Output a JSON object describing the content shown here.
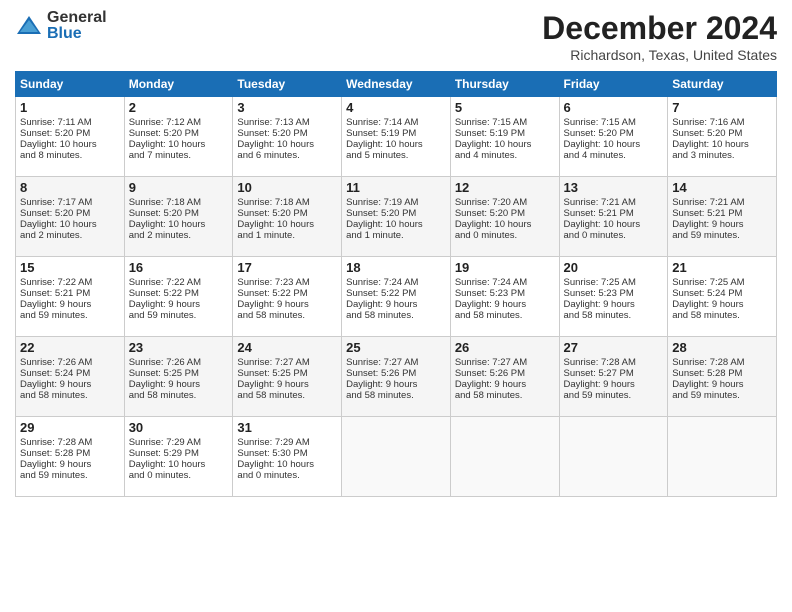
{
  "logo": {
    "general": "General",
    "blue": "Blue"
  },
  "header": {
    "month": "December 2024",
    "location": "Richardson, Texas, United States"
  },
  "weekdays": [
    "Sunday",
    "Monday",
    "Tuesday",
    "Wednesday",
    "Thursday",
    "Friday",
    "Saturday"
  ],
  "weeks": [
    [
      {
        "day": "1",
        "lines": [
          "Sunrise: 7:11 AM",
          "Sunset: 5:20 PM",
          "Daylight: 10 hours",
          "and 8 minutes."
        ]
      },
      {
        "day": "2",
        "lines": [
          "Sunrise: 7:12 AM",
          "Sunset: 5:20 PM",
          "Daylight: 10 hours",
          "and 7 minutes."
        ]
      },
      {
        "day": "3",
        "lines": [
          "Sunrise: 7:13 AM",
          "Sunset: 5:20 PM",
          "Daylight: 10 hours",
          "and 6 minutes."
        ]
      },
      {
        "day": "4",
        "lines": [
          "Sunrise: 7:14 AM",
          "Sunset: 5:19 PM",
          "Daylight: 10 hours",
          "and 5 minutes."
        ]
      },
      {
        "day": "5",
        "lines": [
          "Sunrise: 7:15 AM",
          "Sunset: 5:19 PM",
          "Daylight: 10 hours",
          "and 4 minutes."
        ]
      },
      {
        "day": "6",
        "lines": [
          "Sunrise: 7:15 AM",
          "Sunset: 5:20 PM",
          "Daylight: 10 hours",
          "and 4 minutes."
        ]
      },
      {
        "day": "7",
        "lines": [
          "Sunrise: 7:16 AM",
          "Sunset: 5:20 PM",
          "Daylight: 10 hours",
          "and 3 minutes."
        ]
      }
    ],
    [
      {
        "day": "8",
        "lines": [
          "Sunrise: 7:17 AM",
          "Sunset: 5:20 PM",
          "Daylight: 10 hours",
          "and 2 minutes."
        ]
      },
      {
        "day": "9",
        "lines": [
          "Sunrise: 7:18 AM",
          "Sunset: 5:20 PM",
          "Daylight: 10 hours",
          "and 2 minutes."
        ]
      },
      {
        "day": "10",
        "lines": [
          "Sunrise: 7:18 AM",
          "Sunset: 5:20 PM",
          "Daylight: 10 hours",
          "and 1 minute."
        ]
      },
      {
        "day": "11",
        "lines": [
          "Sunrise: 7:19 AM",
          "Sunset: 5:20 PM",
          "Daylight: 10 hours",
          "and 1 minute."
        ]
      },
      {
        "day": "12",
        "lines": [
          "Sunrise: 7:20 AM",
          "Sunset: 5:20 PM",
          "Daylight: 10 hours",
          "and 0 minutes."
        ]
      },
      {
        "day": "13",
        "lines": [
          "Sunrise: 7:21 AM",
          "Sunset: 5:21 PM",
          "Daylight: 10 hours",
          "and 0 minutes."
        ]
      },
      {
        "day": "14",
        "lines": [
          "Sunrise: 7:21 AM",
          "Sunset: 5:21 PM",
          "Daylight: 9 hours",
          "and 59 minutes."
        ]
      }
    ],
    [
      {
        "day": "15",
        "lines": [
          "Sunrise: 7:22 AM",
          "Sunset: 5:21 PM",
          "Daylight: 9 hours",
          "and 59 minutes."
        ]
      },
      {
        "day": "16",
        "lines": [
          "Sunrise: 7:22 AM",
          "Sunset: 5:22 PM",
          "Daylight: 9 hours",
          "and 59 minutes."
        ]
      },
      {
        "day": "17",
        "lines": [
          "Sunrise: 7:23 AM",
          "Sunset: 5:22 PM",
          "Daylight: 9 hours",
          "and 58 minutes."
        ]
      },
      {
        "day": "18",
        "lines": [
          "Sunrise: 7:24 AM",
          "Sunset: 5:22 PM",
          "Daylight: 9 hours",
          "and 58 minutes."
        ]
      },
      {
        "day": "19",
        "lines": [
          "Sunrise: 7:24 AM",
          "Sunset: 5:23 PM",
          "Daylight: 9 hours",
          "and 58 minutes."
        ]
      },
      {
        "day": "20",
        "lines": [
          "Sunrise: 7:25 AM",
          "Sunset: 5:23 PM",
          "Daylight: 9 hours",
          "and 58 minutes."
        ]
      },
      {
        "day": "21",
        "lines": [
          "Sunrise: 7:25 AM",
          "Sunset: 5:24 PM",
          "Daylight: 9 hours",
          "and 58 minutes."
        ]
      }
    ],
    [
      {
        "day": "22",
        "lines": [
          "Sunrise: 7:26 AM",
          "Sunset: 5:24 PM",
          "Daylight: 9 hours",
          "and 58 minutes."
        ]
      },
      {
        "day": "23",
        "lines": [
          "Sunrise: 7:26 AM",
          "Sunset: 5:25 PM",
          "Daylight: 9 hours",
          "and 58 minutes."
        ]
      },
      {
        "day": "24",
        "lines": [
          "Sunrise: 7:27 AM",
          "Sunset: 5:25 PM",
          "Daylight: 9 hours",
          "and 58 minutes."
        ]
      },
      {
        "day": "25",
        "lines": [
          "Sunrise: 7:27 AM",
          "Sunset: 5:26 PM",
          "Daylight: 9 hours",
          "and 58 minutes."
        ]
      },
      {
        "day": "26",
        "lines": [
          "Sunrise: 7:27 AM",
          "Sunset: 5:26 PM",
          "Daylight: 9 hours",
          "and 58 minutes."
        ]
      },
      {
        "day": "27",
        "lines": [
          "Sunrise: 7:28 AM",
          "Sunset: 5:27 PM",
          "Daylight: 9 hours",
          "and 59 minutes."
        ]
      },
      {
        "day": "28",
        "lines": [
          "Sunrise: 7:28 AM",
          "Sunset: 5:28 PM",
          "Daylight: 9 hours",
          "and 59 minutes."
        ]
      }
    ],
    [
      {
        "day": "29",
        "lines": [
          "Sunrise: 7:28 AM",
          "Sunset: 5:28 PM",
          "Daylight: 9 hours",
          "and 59 minutes."
        ]
      },
      {
        "day": "30",
        "lines": [
          "Sunrise: 7:29 AM",
          "Sunset: 5:29 PM",
          "Daylight: 10 hours",
          "and 0 minutes."
        ]
      },
      {
        "day": "31",
        "lines": [
          "Sunrise: 7:29 AM",
          "Sunset: 5:30 PM",
          "Daylight: 10 hours",
          "and 0 minutes."
        ]
      },
      null,
      null,
      null,
      null
    ]
  ]
}
